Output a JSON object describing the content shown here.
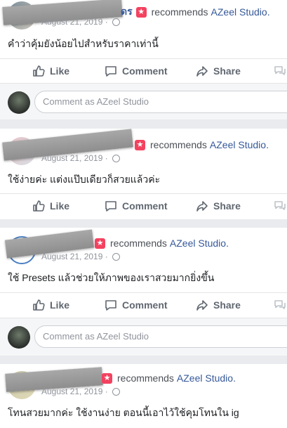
{
  "posts": [
    {
      "recommends": "recommends",
      "page": "AZeel Studio.",
      "date": "August 21, 2019 ·",
      "text": "คำว่าคุ้มยังน้อยไปสำหรับราคาเท่านี้",
      "name_fragment": "ดร"
    },
    {
      "recommends": "recommends",
      "page": "AZeel Studio.",
      "date": "August 21, 2019 ·",
      "text": "ใช้ง่ายค่ะ แต่งแป๊บเดียวก็สวยแล้วค่ะ"
    },
    {
      "recommends": "recommends",
      "page": "AZeel Studio.",
      "date": "August 21, 2019 ·",
      "text": "ใช้ Presets แล้วช่วยให้ภาพของเราสวยมากยิ่งขึ้น"
    },
    {
      "recommends": "recommends",
      "page": "AZeel Studio.",
      "date": "August 21, 2019 ·",
      "text": "โทนสวยมากค่ะ ใช้งานง่าย ตอนนี้เอาไว้ใช้คุมโทนใน ig"
    }
  ],
  "actions": {
    "like": "Like",
    "comment": "Comment",
    "share": "Share"
  },
  "comment_box": {
    "placeholder": "Comment as AZeel Studio"
  },
  "colors": {
    "link": "#365899",
    "badge": "#f3425f",
    "action_text": "#606770",
    "background": "#e9ebee"
  },
  "icons": [
    "like-icon",
    "comment-icon",
    "share-icon",
    "messenger-icon",
    "recommend-badge-icon",
    "globe-icon"
  ]
}
